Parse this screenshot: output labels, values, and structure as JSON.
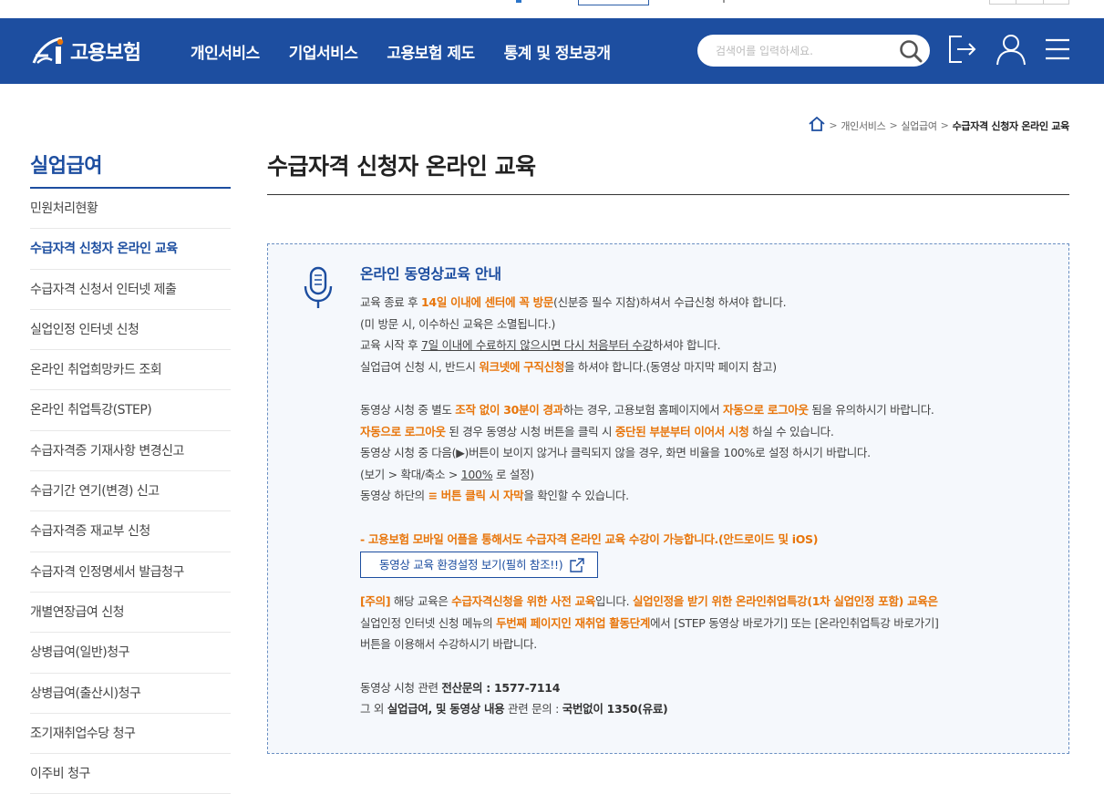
{
  "header": {
    "logo_text": "고용보험",
    "nav": [
      "개인서비스",
      "기업서비스",
      "고용보험 제도",
      "통계 및 정보공개"
    ],
    "search_placeholder": "검색어를 입력하세요."
  },
  "breadcrumb": {
    "items": [
      "개인서비스",
      "실업급여"
    ],
    "current": "수급자격 신청자 온라인 교육"
  },
  "sidebar": {
    "title": "실업급여",
    "items": [
      "민원처리현황",
      "수급자격 신청자 온라인 교육",
      "수급자격 신청서 인터넷 제출",
      "실업인정 인터넷 신청",
      "온라인 취업희망카드 조회",
      "온라인 취업특강(STEP)",
      "수급자격증 기재사항 변경신고",
      "수급기간 연기(변경) 신고",
      "수급자격증 재교부 신청",
      "수급자격 인정명세서 발급청구",
      "개별연장급여 신청",
      "상병급여(일반)청구",
      "상병급여(출산시)청구",
      "조기재취업수당 청구",
      "이주비 청구"
    ],
    "active_index": 1
  },
  "page": {
    "title": "수급자격 신청자 온라인 교육"
  },
  "notice": {
    "title": "온라인 동영상교육 안내",
    "p1": {
      "a": "교육 종료 후 ",
      "b": "14일 이내에 센터에 꼭 방문",
      "c": "(신분증 필수 지참)하셔서 수급신청 하셔야 합니다."
    },
    "p2": "(미 방문 시, 이수하신 교육은 소멸됩니다.)",
    "p3": {
      "a": "교육 시작 후 ",
      "b": "7일 이내에 수료하지 않으시면 다시 처음부터 수강",
      "c": "하셔야 합니다."
    },
    "p4": {
      "a": "실업급여 신청 시, 반드시 ",
      "b": "워크넷에 구직신청",
      "c": "을 하셔야 합니다.(동영상 마지막 페이지 참고)"
    },
    "p5": {
      "a": "동영상 시청 중 별도 ",
      "b": "조작 없이 30분이 경과",
      "c": "하는 경우, 고용보험 홈페이지에서 ",
      "d": "자동으로 로그아웃",
      "e": " 됨을 유의하시기 바랍니다."
    },
    "p6": {
      "a": "자동으로 로그아웃",
      "b": " 된 경우 동영상 시청 버튼을 클릭 시 ",
      "c": "중단된 부분부터 이어서 시청",
      "d": " 하실 수 있습니다."
    },
    "p7": "동영상 시청 중 다음(▶)버튼이 보이지 않거나 클릭되지 않을 경우, 화면 비율을 100%로 설정 하시기 바랍니다.",
    "p8": {
      "a": "(보기 > 확대/축소 > ",
      "b": "100%",
      "c": " 로 설정)"
    },
    "p9": {
      "a": "동영상 하단의 ",
      "b": "≡ 버튼 클릭 시 자막",
      "c": "을 확인할 수 있습니다."
    },
    "mobile": "- 고용보험 모바일 어플을 통해서도 수급자격 온라인 교육 수강이 가능합니다.(안드로이드 및 iOS)",
    "button_label": "동영상 교육 환경설정 보기(필히 참조!!)",
    "caution": {
      "a": "[주의]",
      "b": " 해당 교육은 ",
      "c": "수급자격신청을 위한 사전 교육",
      "d": "입니다. ",
      "e": "실업인정을 받기 위한 온라인취업특강(1차 실업인정 포함) 교육은"
    },
    "caution2": {
      "a": "실업인정 인터넷 신청 메뉴의 ",
      "b": "두번째 페이지인 재취업 활동단계",
      "c": "에서 [STEP 동영상 바로가기] 또는 [온라인취업특강 바로가기]"
    },
    "caution3": "버튼을 이용해서 수강하시기 바랍니다.",
    "contact1": {
      "a": "동영상 시청 관련 ",
      "b": "전산문의 : 1577-7114"
    },
    "contact2": {
      "a": "그 외 ",
      "b": "실업급여, 및 동영상 내용",
      "c": " 관련 문의 : ",
      "d": "국번없이 1350(유료)"
    }
  }
}
